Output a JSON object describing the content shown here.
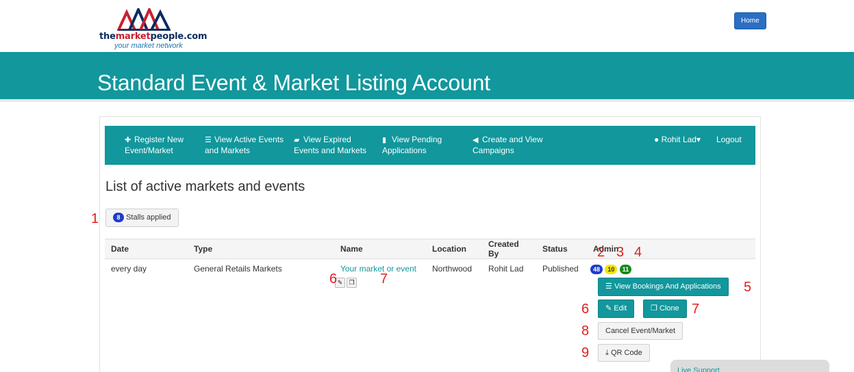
{
  "brand": {
    "name_prefix": "the",
    "name_accent": "market",
    "name_suffix": "people.com",
    "tagline": "your market network"
  },
  "header": {
    "home_label": "Home",
    "banner_title": "Standard Event & Market Listing Account"
  },
  "nav": {
    "items": [
      {
        "icon": "plus-icon",
        "line1": "Register New",
        "line2": "Event/Market"
      },
      {
        "icon": "list-icon",
        "line1": "View Active Events",
        "line2": "and Markets"
      },
      {
        "icon": "folder-icon",
        "line1": "View Expired",
        "line2": "Events and Markets"
      },
      {
        "icon": "file-icon",
        "line1": "View Pending",
        "line2": "Applications"
      },
      {
        "icon": "megaphone-icon",
        "line1": "Create and View",
        "line2": "Campaigns"
      }
    ],
    "user": "Rohit Lad",
    "logout": "Logout"
  },
  "main": {
    "heading": "List of active markets and events",
    "stalls_count": "8",
    "stalls_label": "Stalls applied"
  },
  "table": {
    "headers": [
      "Date",
      "Type",
      "Name",
      "Location",
      "Created By",
      "Status",
      "Admin"
    ],
    "row": {
      "date": "every day",
      "type": "General Retails Markets",
      "name": "Your market or event",
      "location": "Northwood",
      "created_by": "Rohit Lad",
      "status": "Published",
      "badge_blue": "48",
      "badge_yellow": "10",
      "badge_green": "11"
    }
  },
  "actions": {
    "view_bookings": "View Bookings And Applications",
    "edit": "Edit",
    "clone": "Clone",
    "cancel": "Cancel Event/Market",
    "qr": "QR Code"
  },
  "annotations": {
    "n1": "1",
    "n2": "2",
    "n3": "3",
    "n4": "4",
    "n5": "5",
    "n6a": "6",
    "n7a": "7",
    "n6b": "6",
    "n7b": "7",
    "n8": "8",
    "n9": "9"
  },
  "live_support": "Live Support",
  "colors": {
    "teal": "#11979c",
    "home_blue": "#2a6fc4",
    "badge_blue": "#1e3cc9",
    "badge_yellow": "#f3e400",
    "badge_green": "#138a1c",
    "annotation_red": "#e02020"
  }
}
